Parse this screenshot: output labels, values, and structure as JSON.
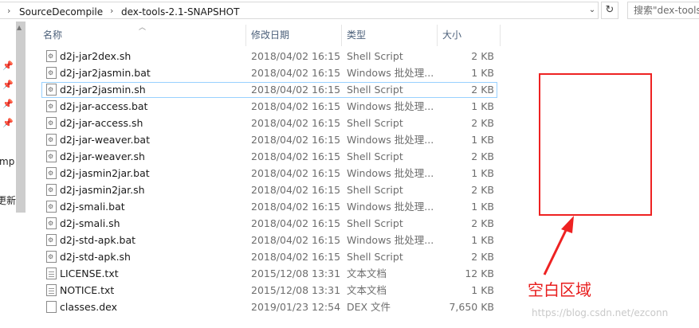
{
  "address_bar": {
    "crumbs": [
      "SourceDecompile",
      "dex-tools-2.1-SNAPSHOT"
    ],
    "search_placeholder": "搜索\"dex-tools"
  },
  "nav_pane": {
    "partial_items": [
      "mp",
      "更新"
    ]
  },
  "columns": {
    "name": "名称",
    "date": "修改日期",
    "type": "类型",
    "size": "大小"
  },
  "files": [
    {
      "name": "d2j-jar2dex.sh",
      "date": "2018/04/02 16:15",
      "type": "Shell Script",
      "size": "2 KB",
      "icon": "script-file-icon"
    },
    {
      "name": "d2j-jar2jasmin.bat",
      "date": "2018/04/02 16:15",
      "type": "Windows 批处理...",
      "size": "1 KB",
      "icon": "batch-file-icon"
    },
    {
      "name": "d2j-jar2jasmin.sh",
      "date": "2018/04/02 16:15",
      "type": "Shell Script",
      "size": "2 KB",
      "icon": "script-file-icon",
      "selected": true
    },
    {
      "name": "d2j-jar-access.bat",
      "date": "2018/04/02 16:15",
      "type": "Windows 批处理...",
      "size": "1 KB",
      "icon": "batch-file-icon"
    },
    {
      "name": "d2j-jar-access.sh",
      "date": "2018/04/02 16:15",
      "type": "Shell Script",
      "size": "2 KB",
      "icon": "script-file-icon"
    },
    {
      "name": "d2j-jar-weaver.bat",
      "date": "2018/04/02 16:15",
      "type": "Windows 批处理...",
      "size": "1 KB",
      "icon": "batch-file-icon"
    },
    {
      "name": "d2j-jar-weaver.sh",
      "date": "2018/04/02 16:15",
      "type": "Shell Script",
      "size": "2 KB",
      "icon": "script-file-icon"
    },
    {
      "name": "d2j-jasmin2jar.bat",
      "date": "2018/04/02 16:15",
      "type": "Windows 批处理...",
      "size": "1 KB",
      "icon": "batch-file-icon"
    },
    {
      "name": "d2j-jasmin2jar.sh",
      "date": "2018/04/02 16:15",
      "type": "Shell Script",
      "size": "2 KB",
      "icon": "script-file-icon"
    },
    {
      "name": "d2j-smali.bat",
      "date": "2018/04/02 16:15",
      "type": "Windows 批处理...",
      "size": "1 KB",
      "icon": "batch-file-icon"
    },
    {
      "name": "d2j-smali.sh",
      "date": "2018/04/02 16:15",
      "type": "Shell Script",
      "size": "2 KB",
      "icon": "script-file-icon"
    },
    {
      "name": "d2j-std-apk.bat",
      "date": "2018/04/02 16:15",
      "type": "Windows 批处理...",
      "size": "1 KB",
      "icon": "batch-file-icon"
    },
    {
      "name": "d2j-std-apk.sh",
      "date": "2018/04/02 16:15",
      "type": "Shell Script",
      "size": "2 KB",
      "icon": "script-file-icon"
    },
    {
      "name": "LICENSE.txt",
      "date": "2015/12/08 13:31",
      "type": "文本文档",
      "size": "12 KB",
      "icon": "text-file-icon"
    },
    {
      "name": "NOTICE.txt",
      "date": "2015/12/08 13:31",
      "type": "文本文档",
      "size": "1 KB",
      "icon": "text-file-icon"
    },
    {
      "name": "classes.dex",
      "date": "2019/01/23 12:54",
      "type": "DEX 文件",
      "size": "7,650 KB",
      "icon": "generic-file-icon"
    }
  ],
  "annotation": {
    "label": "空白区域",
    "color": "#e81e1e"
  },
  "watermark": "https://blog.csdn.net/ezconn"
}
